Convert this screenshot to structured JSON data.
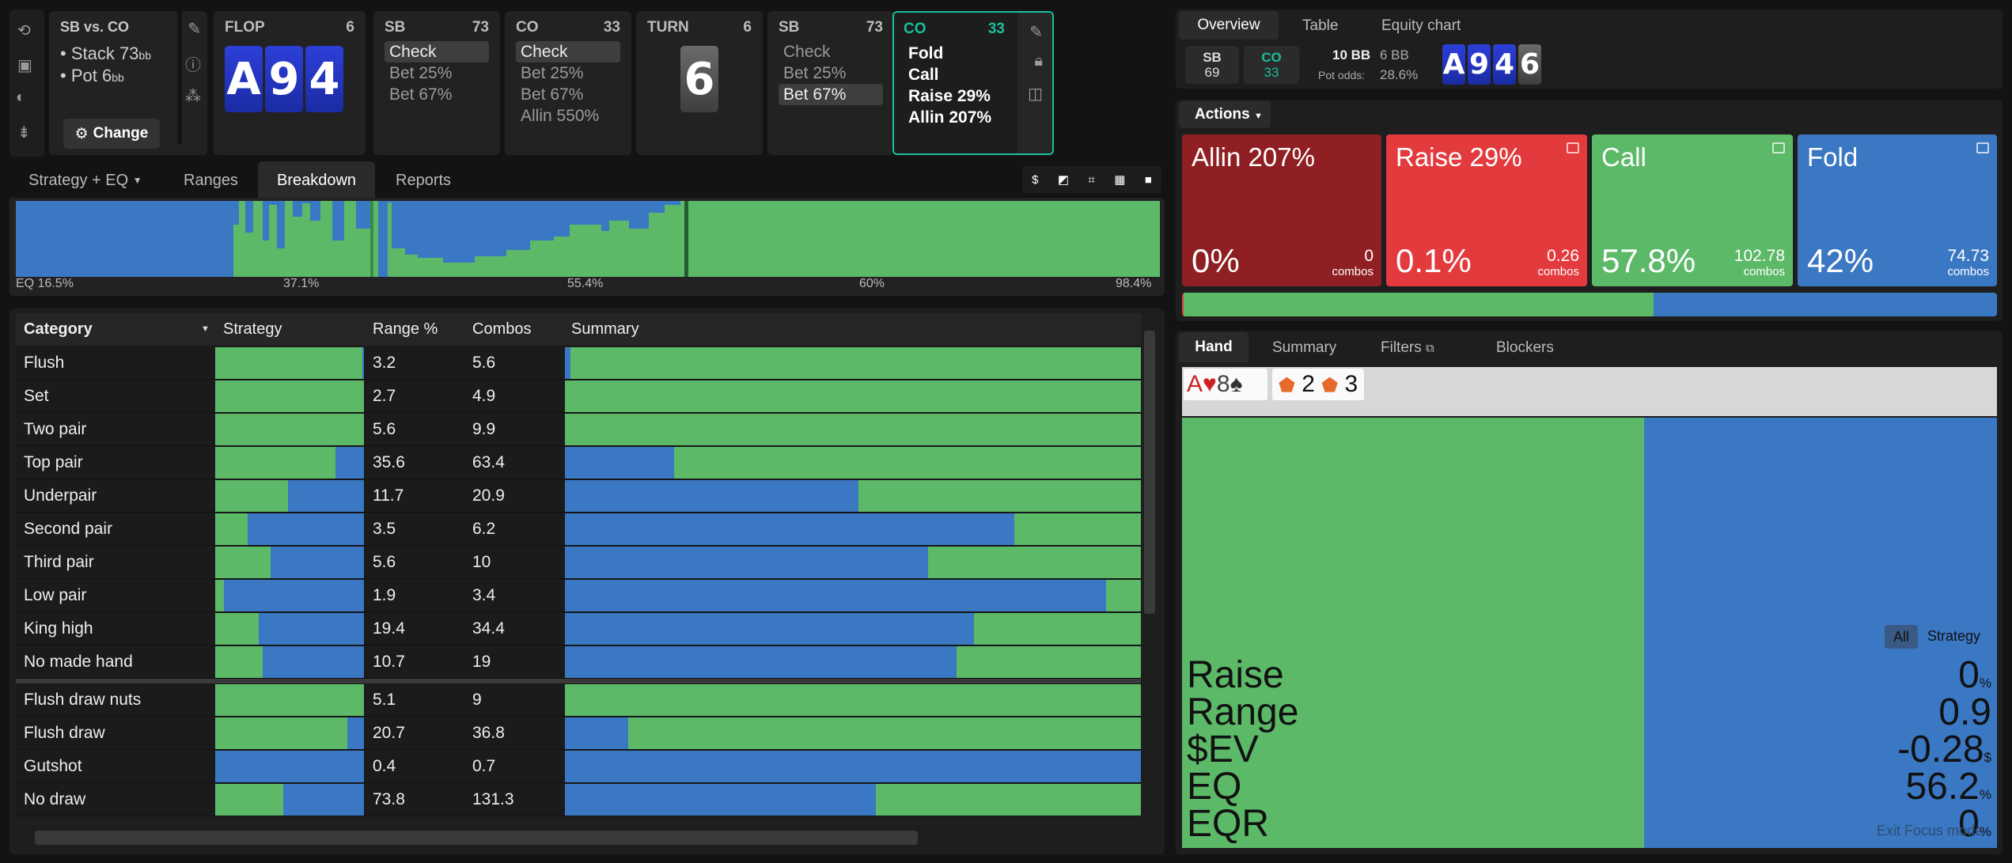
{
  "sidebar": {
    "icons": [
      "undo-icon",
      "save-icon",
      "gamepad-icon",
      "align-icon"
    ]
  },
  "scenario": {
    "title": "SB vs. CO",
    "stack": "• Stack 73",
    "stack_unit": "bb",
    "pot": "• Pot 6",
    "pot_unit": "bb",
    "change_label": "Change"
  },
  "flop": {
    "label": "FLOP",
    "count": "6",
    "cards": [
      "A",
      "9",
      "4"
    ]
  },
  "sb1": {
    "label": "SB",
    "count": "73",
    "actions": [
      "Check",
      "Bet 25%",
      "Bet 67%"
    ]
  },
  "co1": {
    "label": "CO",
    "count": "33",
    "actions": [
      "Check",
      "Bet 25%",
      "Bet 67%",
      "Allin 550%"
    ]
  },
  "turn": {
    "label": "TURN",
    "count": "6",
    "card": "6"
  },
  "sb2": {
    "label": "SB",
    "count": "73",
    "actions": [
      "Check",
      "Bet 25%",
      "Bet 67%"
    ]
  },
  "co2": {
    "label": "CO",
    "count": "33",
    "actions": [
      "Fold",
      "Call",
      "Raise 29%",
      "Allin 207%"
    ]
  },
  "tabs": {
    "strategy": "Strategy + EQ",
    "ranges": "Ranges",
    "breakdown": "Breakdown",
    "reports": "Reports"
  },
  "toolbar": {
    "dollar": "$"
  },
  "eq_axis": [
    "EQ 16.5%",
    "37.1%",
    "55.4%",
    "60%",
    "98.4%"
  ],
  "table": {
    "headers": {
      "category": "Category",
      "strategy": "Strategy",
      "range": "Range %",
      "combos": "Combos",
      "summary": "Summary"
    },
    "rows": [
      {
        "name": "Flush",
        "range": "3.2",
        "combos": "5.6",
        "call": 0.99
      },
      {
        "name": "Set",
        "range": "2.7",
        "combos": "4.9",
        "call": 1.0
      },
      {
        "name": "Two pair",
        "range": "5.6",
        "combos": "9.9",
        "call": 1.0
      },
      {
        "name": "Top pair",
        "range": "35.6",
        "combos": "63.4",
        "call": 0.81
      },
      {
        "name": "Underpair",
        "range": "11.7",
        "combos": "20.9",
        "call": 0.49
      },
      {
        "name": "Second pair",
        "range": "3.5",
        "combos": "6.2",
        "call": 0.22
      },
      {
        "name": "Third pair",
        "range": "5.6",
        "combos": "10",
        "call": 0.37
      },
      {
        "name": "Low pair",
        "range": "1.9",
        "combos": "3.4",
        "call": 0.06
      },
      {
        "name": "King high",
        "range": "19.4",
        "combos": "34.4",
        "call": 0.29
      },
      {
        "name": "No made hand",
        "range": "10.7",
        "combos": "19",
        "call": 0.32
      },
      {
        "name": "Flush draw nuts",
        "range": "5.1",
        "combos": "9",
        "call": 1.0
      },
      {
        "name": "Flush draw",
        "range": "20.7",
        "combos": "36.8",
        "call": 0.89
      },
      {
        "name": "Gutshot",
        "range": "0.4",
        "combos": "0.7",
        "call": 0.0
      },
      {
        "name": "No draw",
        "range": "73.8",
        "combos": "131.3",
        "call": 0.46
      }
    ]
  },
  "right": {
    "tabs": {
      "overview": "Overview",
      "table": "Table",
      "equity": "Equity chart"
    },
    "sb": {
      "name": "SB",
      "val": "69"
    },
    "co": {
      "name": "CO",
      "val": "33"
    },
    "pot": {
      "bb10": "10 BB",
      "bb6": "6 BB",
      "odds_label": "Pot odds:",
      "odds": "28.6%"
    },
    "board": [
      "A",
      "9",
      "4",
      "6"
    ],
    "actions_label": "Actions",
    "cards": [
      {
        "title": "Allin 207%",
        "pct": "0%",
        "combos": "0",
        "unit": "combos",
        "color": "#8f1f22"
      },
      {
        "title": "Raise 29%",
        "pct": "0.1%",
        "combos": "0.26",
        "unit": "combos",
        "color": "#e33a3e"
      },
      {
        "title": "Call",
        "pct": "57.8%",
        "combos": "102.78",
        "unit": "combos",
        "color": "#5cb968"
      },
      {
        "title": "Fold",
        "pct": "42%",
        "combos": "74.73",
        "unit": "combos",
        "color": "#3b78c3"
      }
    ],
    "subtabs": {
      "hand": "Hand",
      "summary": "Summary",
      "filters": "Filters",
      "blockers": "Blockers"
    },
    "hand_chips": [
      {
        "a": "A",
        "b": "8"
      },
      {
        "a": "2",
        "b": "3"
      }
    ],
    "toggle": {
      "all": "All",
      "strategy": "Strategy"
    },
    "stats": [
      {
        "label": "Raise",
        "value": "0",
        "unit": "%"
      },
      {
        "label": "Range",
        "value": "0.9",
        "unit": ""
      },
      {
        "label": "$EV",
        "value": "-0.28",
        "unit": "$"
      },
      {
        "label": "EQ",
        "value": "56.2",
        "unit": "%"
      },
      {
        "label": "EQR",
        "value": "0",
        "unit": "%"
      }
    ],
    "exit_focus": "Exit Focus mode"
  },
  "colors": {
    "call": "#5cb968",
    "fold": "#3b78c3",
    "raise": "#e33a3e",
    "allin": "#8f1f22",
    "accent": "#1bbf9b"
  }
}
